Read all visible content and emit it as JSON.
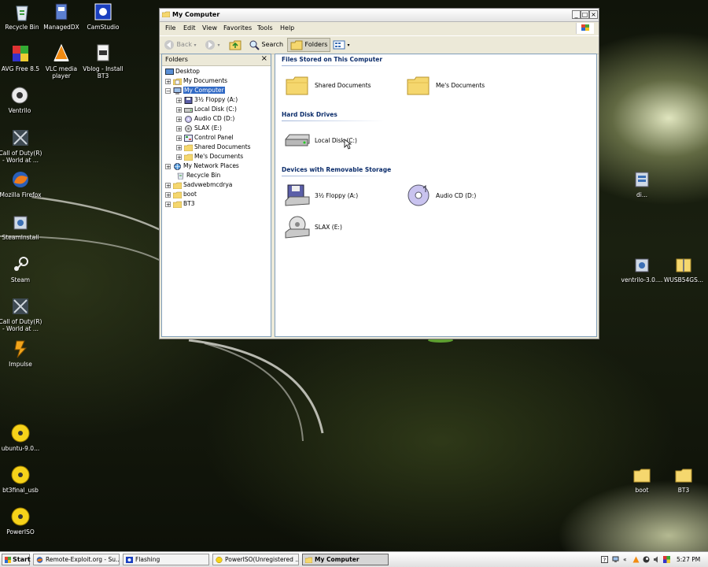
{
  "desktop": {
    "left_icons": [
      {
        "label": "Recycle Bin",
        "icon": "recycle-bin-icon"
      },
      {
        "label": "ManagedDX",
        "icon": "managed-dx-icon"
      },
      {
        "label": "CamStudio",
        "icon": "camstudio-icon"
      },
      {
        "label": "AVG Free 8.5",
        "icon": "avg-icon"
      },
      {
        "label": "VLC media player",
        "icon": "vlc-icon"
      },
      {
        "label": "Vblog - Install BT3",
        "icon": "avi-file-icon"
      },
      {
        "label": "Ventrilo",
        "icon": "ventrilo-icon"
      },
      {
        "label": "Call of Duty(R) - World at ...",
        "icon": "call-of-duty-icon"
      },
      {
        "label": "Mozilla Firefox",
        "icon": "firefox-icon"
      },
      {
        "label": "SteamInstall",
        "icon": "installer-icon"
      },
      {
        "label": "Steam",
        "icon": "steam-icon"
      },
      {
        "label": "Call of Duty(R) - World at ...",
        "icon": "call-of-duty-icon"
      },
      {
        "label": "Impulse",
        "icon": "impulse-icon"
      },
      {
        "label": "ubuntu-9.0...",
        "icon": "disc-image-icon"
      },
      {
        "label": "bt3final_usb",
        "icon": "disc-image-icon"
      },
      {
        "label": "PowerISO",
        "icon": "disc-image-icon"
      }
    ],
    "right_icons": [
      {
        "label": "di...",
        "icon": "installer-icon"
      },
      {
        "label": "ventrilo-3.0....",
        "icon": "installer-icon"
      },
      {
        "label": "WUSB54GS...",
        "icon": "zip-folder-icon"
      },
      {
        "label": "boot",
        "icon": "folder-icon"
      },
      {
        "label": "BT3",
        "icon": "folder-icon"
      }
    ]
  },
  "window": {
    "title": "My Computer",
    "controls": {
      "minimize": "_",
      "maximize": "□",
      "close": "×"
    },
    "menu": [
      "File",
      "Edit",
      "View",
      "Favorites",
      "Tools",
      "Help"
    ],
    "toolbar": {
      "back": "Back",
      "search": "Search",
      "folders": "Folders"
    },
    "folders_pane": {
      "title": "Folders",
      "close": "×",
      "tree": [
        {
          "label": "Desktop",
          "level": 0,
          "expander": "",
          "icon": "desktop-icon"
        },
        {
          "label": "My Documents",
          "level": 1,
          "expander": "+",
          "icon": "my-documents-icon"
        },
        {
          "label": "My Computer",
          "level": 1,
          "expander": "−",
          "icon": "my-computer-icon",
          "selected": true
        },
        {
          "label": "3½ Floppy (A:)",
          "level": 2,
          "expander": "+",
          "icon": "floppy-icon"
        },
        {
          "label": "Local Disk (C:)",
          "level": 2,
          "expander": "+",
          "icon": "hard-disk-icon"
        },
        {
          "label": "Audio CD (D:)",
          "level": 2,
          "expander": "+",
          "icon": "cd-icon"
        },
        {
          "label": "SLAX (E:)",
          "level": 2,
          "expander": "+",
          "icon": "removable-disk-icon"
        },
        {
          "label": "Control Panel",
          "level": 2,
          "expander": "+",
          "icon": "control-panel-icon"
        },
        {
          "label": "Shared Documents",
          "level": 2,
          "expander": "+",
          "icon": "folder-icon"
        },
        {
          "label": "Me's Documents",
          "level": 2,
          "expander": "+",
          "icon": "folder-icon"
        },
        {
          "label": "My Network Places",
          "level": 1,
          "expander": "+",
          "icon": "network-icon"
        },
        {
          "label": "Recycle Bin",
          "level": 1,
          "expander": "",
          "icon": "recycle-bin-icon"
        },
        {
          "label": "Sadvwebmcdrya",
          "level": 1,
          "expander": "+",
          "icon": "folder-icon"
        },
        {
          "label": "boot",
          "level": 1,
          "expander": "+",
          "icon": "folder-icon"
        },
        {
          "label": "BT3",
          "level": 1,
          "expander": "+",
          "icon": "folder-icon"
        }
      ]
    },
    "groups": [
      {
        "title": "Files Stored on This Computer",
        "items": [
          {
            "label": "Shared Documents",
            "icon": "folder-icon"
          },
          {
            "label": "Me's Documents",
            "icon": "folder-icon"
          }
        ]
      },
      {
        "title": "Hard Disk Drives",
        "items": [
          {
            "label": "Local Disk (C:)",
            "icon": "hard-disk-icon"
          }
        ]
      },
      {
        "title": "Devices with Removable Storage",
        "items": [
          {
            "label": "3½ Floppy (A:)",
            "icon": "floppy-icon"
          },
          {
            "label": "Audio CD (D:)",
            "icon": "cd-icon"
          },
          {
            "label": "SLAX (E:)",
            "icon": "removable-disk-icon"
          }
        ]
      }
    ]
  },
  "taskbar": {
    "start": "Start",
    "tasks": [
      {
        "label": "Remote-Exploit.org - Su...",
        "icon": "firefox-icon",
        "active": false
      },
      {
        "label": "Flashing",
        "icon": "camstudio-icon",
        "active": false
      },
      {
        "label": "PowerISO(Unregistered ...",
        "icon": "disc-image-icon",
        "active": false
      },
      {
        "label": "My Computer",
        "icon": "folder-icon",
        "active": true
      }
    ],
    "clock": "5:27 PM",
    "tray_chevron": "«"
  },
  "colors": {
    "selection": "#316ac5",
    "group_title": "#0c2d6b",
    "folder_yellow": "#f5d76e"
  }
}
